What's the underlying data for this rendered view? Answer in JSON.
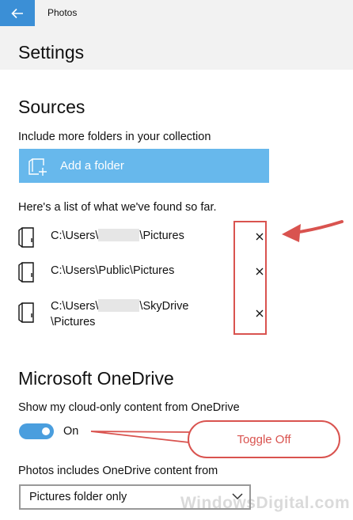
{
  "titlebar": {
    "app_title": "Photos"
  },
  "header": {
    "page_title": "Settings"
  },
  "sources": {
    "title": "Sources",
    "include_text": "Include more folders in your collection",
    "add_folder_label": "Add a folder",
    "list_intro": "Here's a list of what we've found so far.",
    "folders": [
      {
        "path_prefix": "C:\\Users\\",
        "path_suffix": "\\Pictures",
        "redacted": true
      },
      {
        "path_full": "C:\\Users\\Public\\Pictures"
      },
      {
        "path_prefix": "C:\\Users\\",
        "path_suffix": "\\SkyDrive",
        "path_line2": "\\Pictures",
        "redacted": true
      }
    ],
    "remove_glyph": "×"
  },
  "onedrive": {
    "title": "Microsoft OneDrive",
    "cloud_content_label": "Show my cloud-only content from OneDrive",
    "toggle_state": "On",
    "includes_label": "Photos includes OneDrive content from",
    "select_value": "Pictures folder only"
  },
  "annotation": {
    "callout_text": "Toggle Off"
  },
  "watermark": "WindowsDigital.com",
  "colors": {
    "accent": "#3b8fd6",
    "add_button": "#67b8ec",
    "annotation_red": "#d9534f",
    "header_bg": "#f2f2f2"
  },
  "icons": {
    "back": "back-arrow-icon",
    "add_folder": "add-folder-icon",
    "folder": "folder-icon",
    "remove": "close-icon",
    "dropdown": "chevron-down-icon"
  }
}
